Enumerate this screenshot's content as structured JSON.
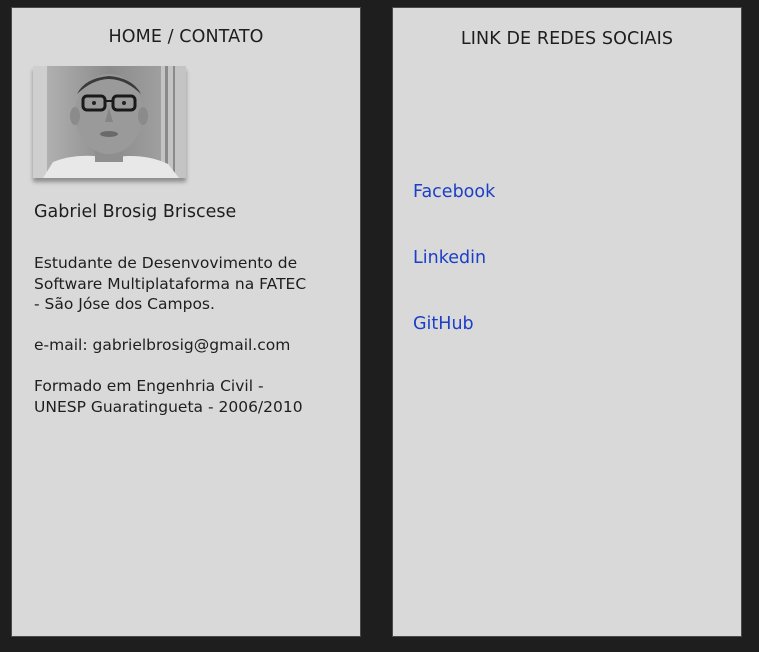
{
  "left_frame": {
    "title": "HOME / CONTATO",
    "name": "Gabriel Brosig Briscese",
    "bio": {
      "paragraph1_lines": [
        "Estudante de Desenvovimento de",
        "Software Multiplataforma na FATEC",
        "- São Jóse dos Campos."
      ],
      "email_line": "e-mail: gabrielbrosig@gmail.com",
      "paragraph3_lines": [
        "Formado em Engenhria Civil -",
        "UNESP Guaratingueta - 2006/2010"
      ]
    }
  },
  "right_frame": {
    "title": "LINK DE REDES SOCIAIS",
    "links": [
      {
        "label": "Facebook"
      },
      {
        "label": "Linkedin"
      },
      {
        "label": "GitHub"
      }
    ]
  },
  "colors": {
    "background": "#1e1e1e",
    "frame": "#d9d9d9",
    "text": "#1e1e1e",
    "link": "#1b3fc7"
  }
}
